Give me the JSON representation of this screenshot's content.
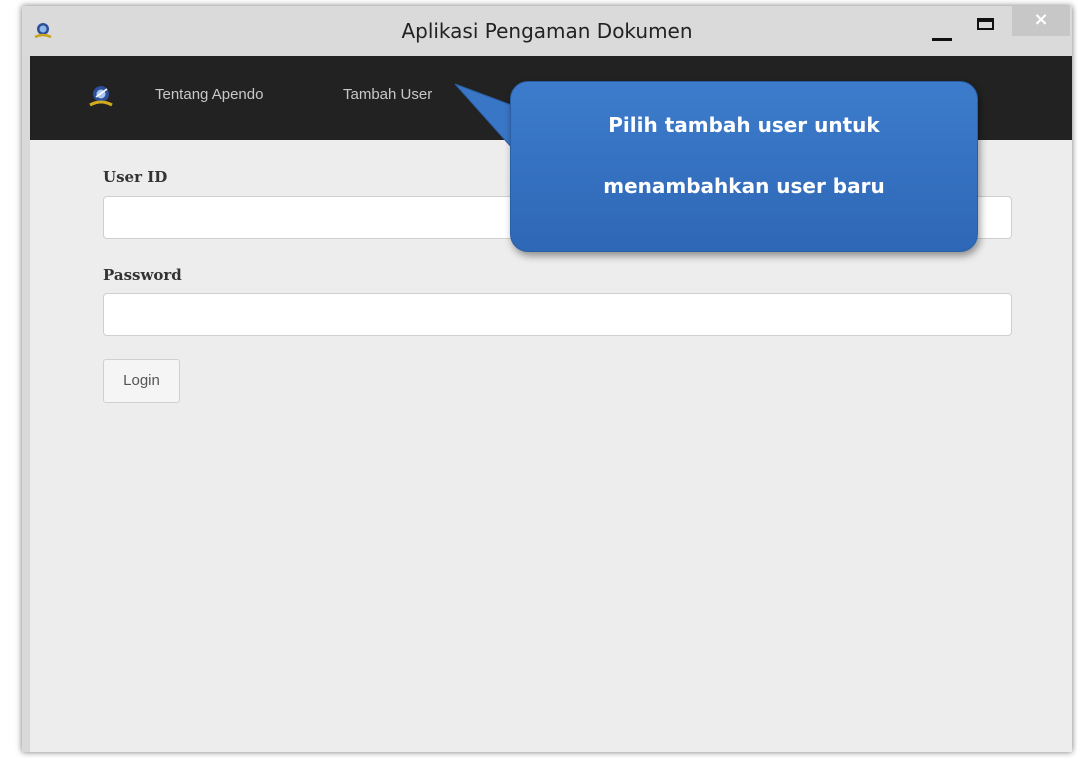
{
  "window": {
    "title": "Aplikasi Pengaman Dokumen",
    "close_glyph": "×"
  },
  "nav": {
    "items": [
      {
        "label": "Tentang Apendo"
      },
      {
        "label": "Tambah User"
      }
    ]
  },
  "form": {
    "userid_label": "User ID",
    "userid_value": "",
    "password_label": "Password",
    "password_value": "",
    "login_label": "Login"
  },
  "callout": {
    "line1": "Pilih tambah user untuk",
    "line2": "menambahkan user baru"
  },
  "colors": {
    "navbar_bg": "#222222",
    "callout_blue": "#3a76c6",
    "client_bg": "#ededed"
  },
  "icons": {
    "app": "apendo-logo-icon"
  }
}
